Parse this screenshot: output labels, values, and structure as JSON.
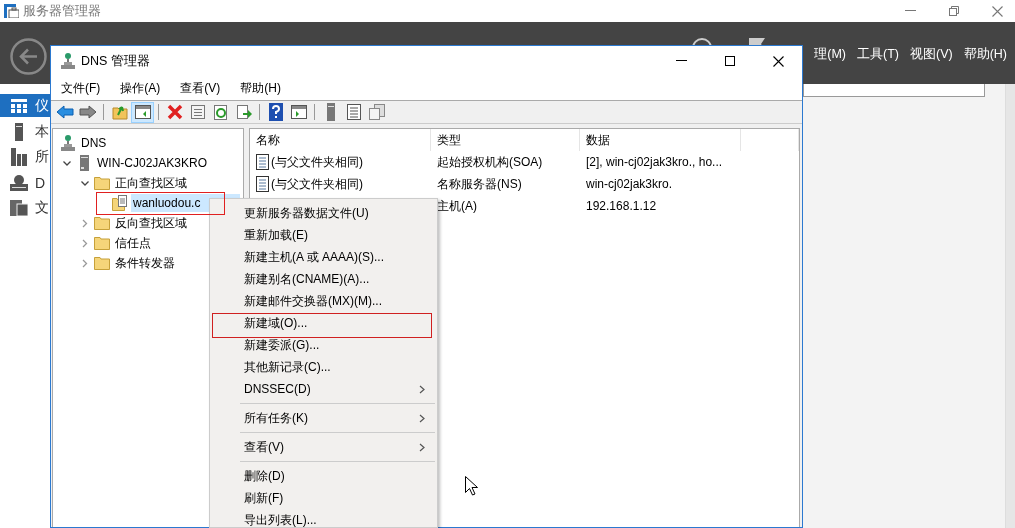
{
  "server_manager": {
    "title": "服务器管理器",
    "menu": [
      "理(M)",
      "工具(T)",
      "视图(V)",
      "帮助(H)"
    ],
    "sidebar": [
      {
        "label": "仪",
        "selected": true
      },
      {
        "label": "本",
        "selected": false
      },
      {
        "label": "所",
        "selected": false
      },
      {
        "label": "D",
        "selected": false
      },
      {
        "label": "文",
        "selected": false
      }
    ]
  },
  "dns_window": {
    "title": "DNS 管理器",
    "menu": [
      "文件(F)",
      "操作(A)",
      "查看(V)",
      "帮助(H)"
    ],
    "toolbar": [
      {
        "kind": "back",
        "pressed": false
      },
      {
        "kind": "forward",
        "pressed": false
      },
      {
        "kind": "separator"
      },
      {
        "kind": "up",
        "pressed": false
      },
      {
        "kind": "pane",
        "pressed": true
      },
      {
        "kind": "separator"
      },
      {
        "kind": "delete",
        "pressed": false
      },
      {
        "kind": "properties",
        "pressed": false
      },
      {
        "kind": "refresh",
        "pressed": false
      },
      {
        "kind": "export",
        "pressed": false
      },
      {
        "kind": "separator"
      },
      {
        "kind": "help",
        "pressed": false
      },
      {
        "kind": "action",
        "pressed": false
      },
      {
        "kind": "separator"
      },
      {
        "kind": "server",
        "pressed": false
      },
      {
        "kind": "list",
        "pressed": false
      },
      {
        "kind": "copy",
        "pressed": false
      }
    ],
    "tree": [
      {
        "kind": "dns",
        "label": "DNS",
        "selected": false,
        "marked": false,
        "children": [
          {
            "kind": "server",
            "label": "WIN-CJ02JAK3KRO",
            "expanded": true,
            "selected": false,
            "marked": false,
            "children": [
              {
                "kind": "folder",
                "label": "正向查找区域",
                "expanded": true,
                "selected": false,
                "marked": false,
                "children": [
                  {
                    "kind": "zone",
                    "label": "wanluodou.c",
                    "selected": true,
                    "marked": true
                  }
                ]
              },
              {
                "kind": "folder",
                "label": "反向查找区域",
                "expanded": false,
                "selected": false,
                "marked": false
              },
              {
                "kind": "folder",
                "label": "信任点",
                "expanded": false,
                "selected": false,
                "marked": false
              },
              {
                "kind": "folder",
                "label": "条件转发器",
                "expanded": false,
                "selected": false,
                "marked": false
              }
            ]
          }
        ]
      }
    ],
    "list": {
      "columns": [
        "名称",
        "类型",
        "数据"
      ],
      "rows": [
        {
          "name": "(与父文件夹相同)",
          "type": "起始授权机构(SOA)",
          "data": "[2], win-cj02jak3kro., ho..."
        },
        {
          "name": "(与父文件夹相同)",
          "type": "名称服务器(NS)",
          "data": "win-cj02jak3kro."
        },
        {
          "type": "主机(A)",
          "data": "192.168.1.12"
        }
      ]
    }
  },
  "context_menu": {
    "items": [
      {
        "kind": "item",
        "label": "更新服务器数据文件(U)",
        "marked": false
      },
      {
        "kind": "item",
        "label": "重新加载(E)",
        "marked": false
      },
      {
        "kind": "item",
        "label": "新建主机(A 或 AAAA)(S)...",
        "marked": false
      },
      {
        "kind": "item",
        "label": "新建别名(CNAME)(A)...",
        "marked": false
      },
      {
        "kind": "item",
        "label": "新建邮件交换器(MX)(M)...",
        "marked": false
      },
      {
        "kind": "item",
        "label": "新建域(O)...",
        "marked": true
      },
      {
        "kind": "item",
        "label": "新建委派(G)...",
        "marked": false
      },
      {
        "kind": "item",
        "label": "其他新记录(C)...",
        "marked": false
      },
      {
        "kind": "submenu",
        "label": "DNSSEC(D)",
        "marked": false
      },
      {
        "kind": "separator"
      },
      {
        "kind": "submenu",
        "label": "所有任务(K)",
        "marked": false
      },
      {
        "kind": "separator"
      },
      {
        "kind": "submenu",
        "label": "查看(V)",
        "marked": false
      },
      {
        "kind": "separator"
      },
      {
        "kind": "item",
        "label": "删除(D)",
        "marked": false
      },
      {
        "kind": "item",
        "label": "刷新(F)",
        "marked": false
      },
      {
        "kind": "item",
        "label": "导出列表(L)...",
        "marked": false
      }
    ]
  }
}
